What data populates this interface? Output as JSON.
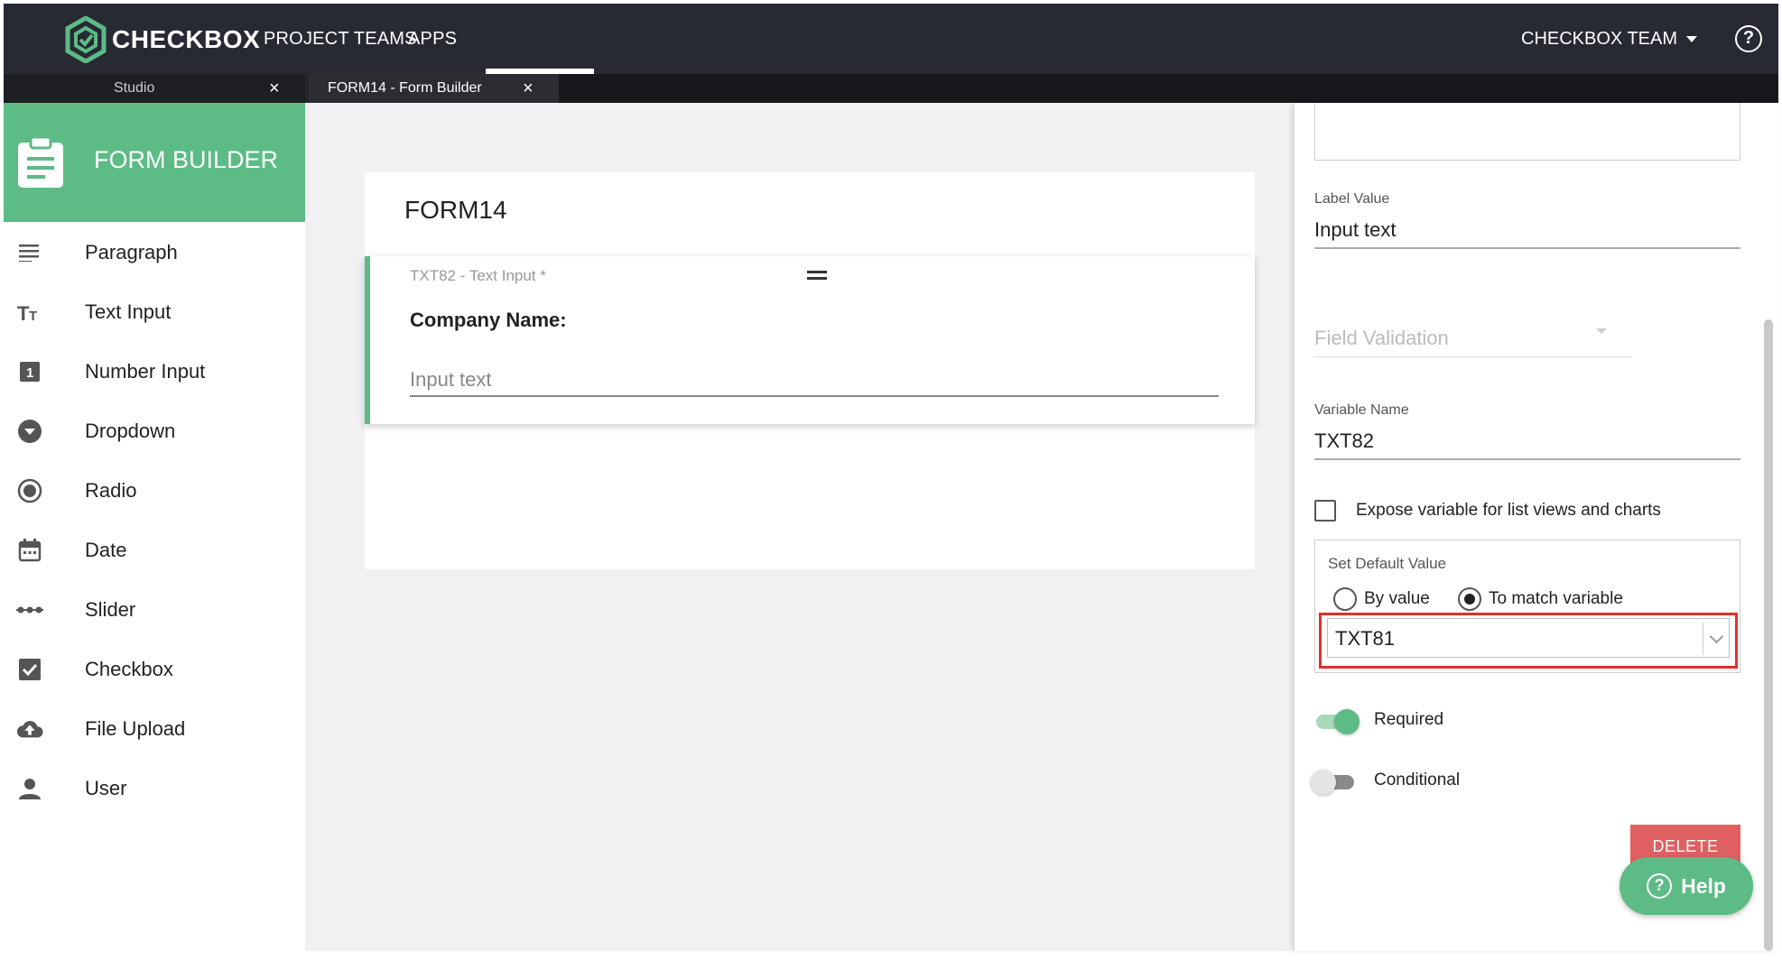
{
  "brand": {
    "name": "CHECKBOX",
    "color": "#5dbb86"
  },
  "topnav": {
    "items": [
      {
        "label": "PROJECT TEAMS",
        "active": false
      },
      {
        "label": "APPS",
        "active": true
      }
    ],
    "team_label": "CHECKBOX TEAM",
    "help_icon": "help-circle-icon",
    "help_glyph": "?"
  },
  "tabs": [
    {
      "label": "Studio",
      "close": "×"
    },
    {
      "label": "FORM14 - Form Builder",
      "close": "×"
    }
  ],
  "sidebar": {
    "title": "FORM BUILDER",
    "items": [
      {
        "label": "Paragraph",
        "icon": "paragraph-icon"
      },
      {
        "label": "Text Input",
        "icon": "text-input-icon"
      },
      {
        "label": "Number Input",
        "icon": "number-input-icon"
      },
      {
        "label": "Dropdown",
        "icon": "dropdown-icon"
      },
      {
        "label": "Radio",
        "icon": "radio-icon"
      },
      {
        "label": "Date",
        "icon": "calendar-icon"
      },
      {
        "label": "Slider",
        "icon": "slider-icon"
      },
      {
        "label": "Checkbox",
        "icon": "checkbox-icon"
      },
      {
        "label": "File Upload",
        "icon": "cloud-upload-icon"
      },
      {
        "label": "User",
        "icon": "user-icon"
      }
    ]
  },
  "form": {
    "title": "FORM14",
    "field": {
      "meta": "TXT82 - Text Input *",
      "label": "Company Name:",
      "placeholder": "Input text"
    }
  },
  "properties": {
    "label_value_caption": "Label Value",
    "label_value": "Input text",
    "field_validation_placeholder": "Field Validation",
    "variable_name_caption": "Variable Name",
    "variable_name": "TXT82",
    "expose_label": "Expose variable for list views and charts",
    "expose_checked": false,
    "default_value": {
      "title": "Set Default Value",
      "options": [
        "By value",
        "To match variable"
      ],
      "selected": "To match variable",
      "variable": "TXT81"
    },
    "required": {
      "label": "Required",
      "on": true
    },
    "conditional": {
      "label": "Conditional",
      "on": false
    },
    "delete_label": "DELETE"
  },
  "help_button": {
    "label": "Help",
    "glyph": "?"
  },
  "colors": {
    "topbar": "#272a33",
    "accent": "#5dbb86",
    "delete": "#e06061",
    "highlight": "#e0302d"
  }
}
